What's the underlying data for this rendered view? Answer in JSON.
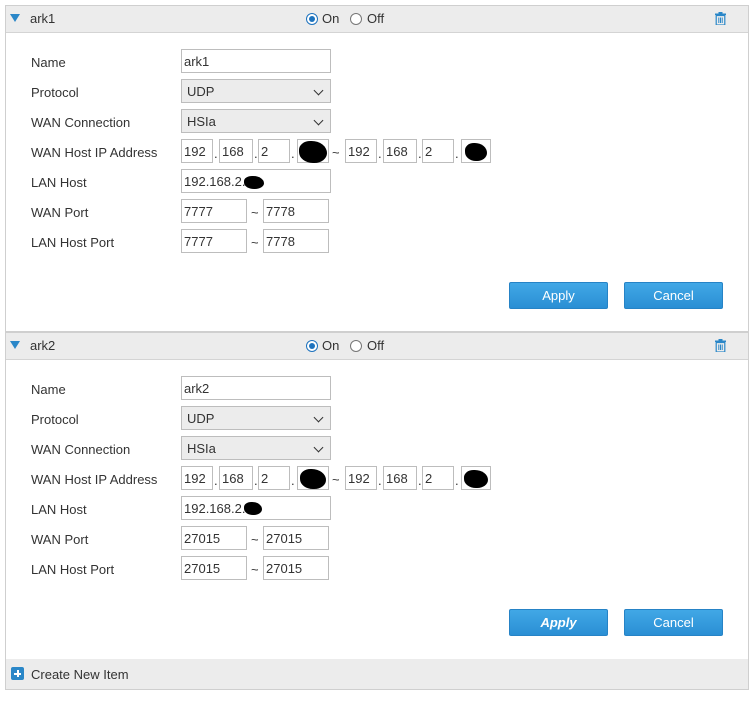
{
  "items": [
    {
      "title": "ark1",
      "on_label": "On",
      "off_label": "Off",
      "state": "On",
      "fields": {
        "name_label": "Name",
        "name_value": "ark1",
        "protocol_label": "Protocol",
        "protocol_value": "UDP",
        "wan_connection_label": "WAN Connection",
        "wan_connection_value": "HSIa",
        "wan_host_ip_label": "WAN Host IP Address",
        "wan_ip_start": [
          "192",
          "168",
          "2"
        ],
        "wan_ip_end": [
          "192",
          "168",
          "2"
        ],
        "lan_host_label": "LAN Host",
        "lan_host_value": "192.168.2.",
        "wan_port_label": "WAN Port",
        "wan_port_start": "7777",
        "wan_port_end": "7778",
        "lan_host_port_label": "LAN Host Port",
        "lan_port_start": "7777",
        "lan_port_end": "7778"
      },
      "range_sep": "~",
      "apply_label": "Apply",
      "cancel_label": "Cancel"
    },
    {
      "title": "ark2",
      "on_label": "On",
      "off_label": "Off",
      "state": "On",
      "fields": {
        "name_label": "Name",
        "name_value": "ark2",
        "protocol_label": "Protocol",
        "protocol_value": "UDP",
        "wan_connection_label": "WAN Connection",
        "wan_connection_value": "HSIa",
        "wan_host_ip_label": "WAN Host IP Address",
        "wan_ip_start": [
          "192",
          "168",
          "2"
        ],
        "wan_ip_end": [
          "192",
          "168",
          "2"
        ],
        "lan_host_label": "LAN Host",
        "lan_host_value": "192.168.2.",
        "wan_port_label": "WAN Port",
        "wan_port_start": "27015",
        "wan_port_end": "27015",
        "lan_host_port_label": "LAN Host Port",
        "lan_port_start": "27015",
        "lan_port_end": "27015"
      },
      "range_sep": "~",
      "apply_label": "Apply",
      "cancel_label": "Cancel"
    }
  ],
  "footer": {
    "create_label": "Create New Item"
  },
  "colors": {
    "accent": "#2a87c8",
    "button": "#2a8fd4",
    "header_bg": "#ececec"
  },
  "icons": {
    "collapse": "triangle-down-icon",
    "delete": "trash-icon",
    "add": "plus-icon"
  }
}
